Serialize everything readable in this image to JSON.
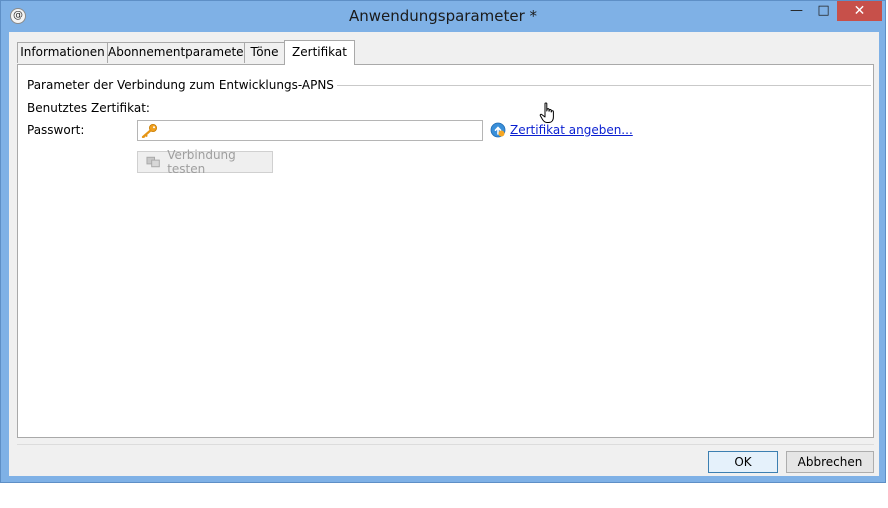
{
  "window": {
    "title": "Anwendungsparameter *",
    "controls": {
      "minimize": "—",
      "maximize": "□",
      "close": "✕"
    }
  },
  "tabs": [
    {
      "label": "Informationen",
      "active": false
    },
    {
      "label": "Abonnementparameter",
      "active": false
    },
    {
      "label": "Töne",
      "active": false
    },
    {
      "label": "Zertifikat",
      "active": true
    }
  ],
  "panel": {
    "group_title": "Parameter der Verbindung zum Entwicklungs-APNS",
    "certificate_label": "Benutztes Zertifikat:",
    "password_label": "Passwort:",
    "password_value": "",
    "specify_certificate_link": "Zertifikat angeben...",
    "test_connection_button": "Verbindung testen"
  },
  "footer": {
    "ok_label": "OK",
    "cancel_label": "Abbrechen"
  },
  "colors": {
    "title_bar": "#7fb1e6",
    "close_button": "#c7504a",
    "link": "#0a1fd1",
    "key_icon": "#f0a020"
  }
}
